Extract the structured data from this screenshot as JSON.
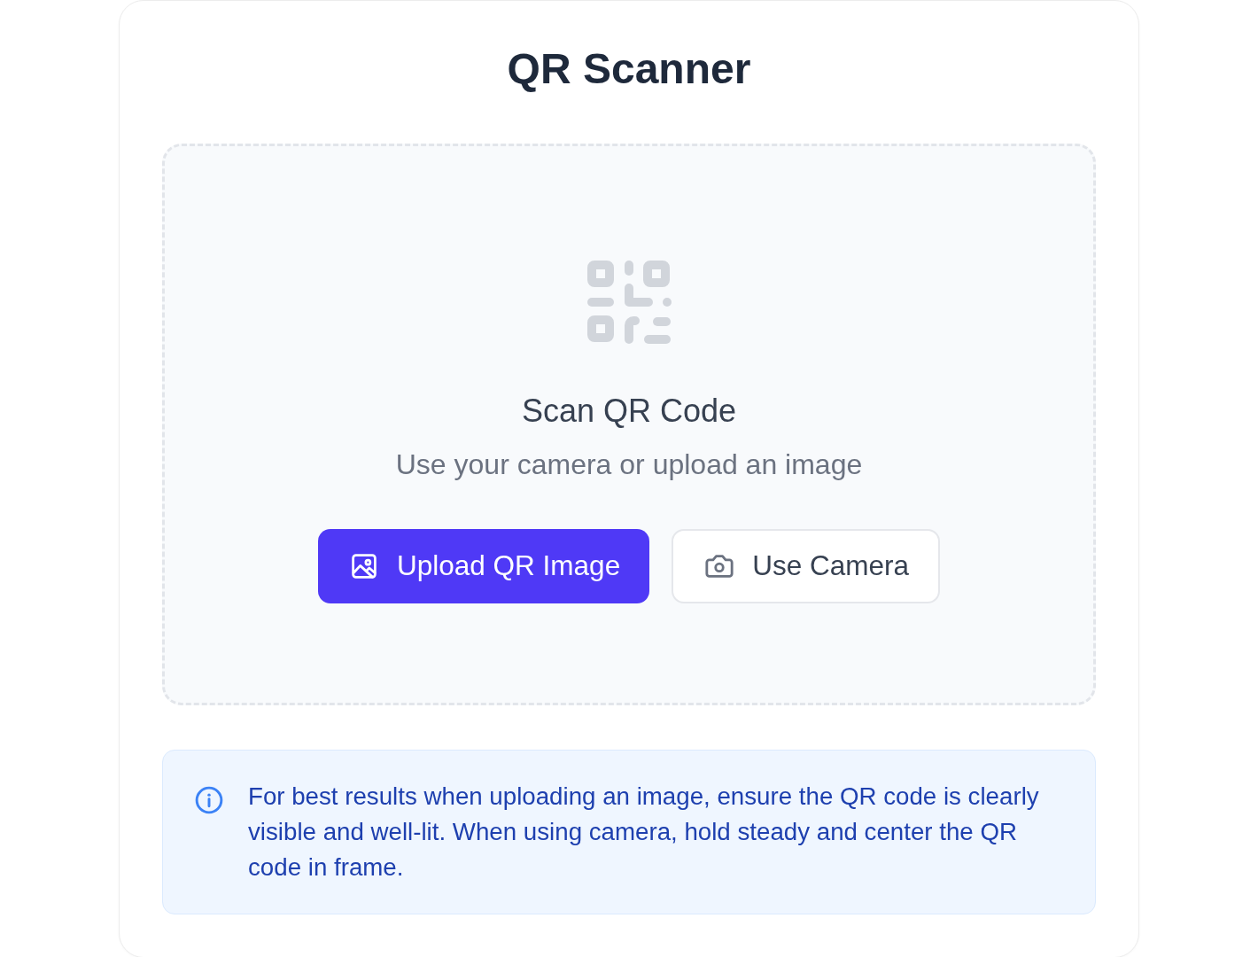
{
  "title": "QR Scanner",
  "dropzone": {
    "heading": "Scan QR Code",
    "subtitle": "Use your camera or upload an image",
    "buttons": [
      {
        "label": "Upload QR Image",
        "kind": "upload"
      },
      {
        "label": "Use Camera",
        "kind": "camera"
      }
    ]
  },
  "tip": {
    "text": "For best results when uploading an image, ensure the QR code is clearly visible and well-lit. When using camera, hold steady and center the QR code in frame."
  }
}
